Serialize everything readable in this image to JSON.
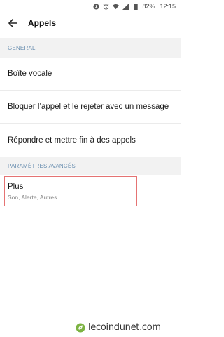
{
  "status_bar": {
    "battery_level": "82%",
    "time": "12:15"
  },
  "app_bar": {
    "title": "Appels",
    "back_icon": "arrow-left-icon"
  },
  "sections": [
    {
      "header": "GENERAL",
      "items": [
        {
          "label": "Boîte vocale"
        },
        {
          "label": "Bloquer l’appel et le rejeter avec un message"
        },
        {
          "label": "Répondre et mettre fin à des appels"
        }
      ]
    },
    {
      "header": "PARAMÈTRES AVANCÉS",
      "items": [
        {
          "label": "Plus",
          "summary": "Son, Alerte, Autres"
        }
      ]
    }
  ],
  "watermark": {
    "text": "lecoindunet.com"
  },
  "colors": {
    "section_header_text": "#6a8fb0",
    "section_header_bg": "#f2f2f2",
    "highlight_border": "#e57373",
    "leaf_green": "#7cb342"
  }
}
